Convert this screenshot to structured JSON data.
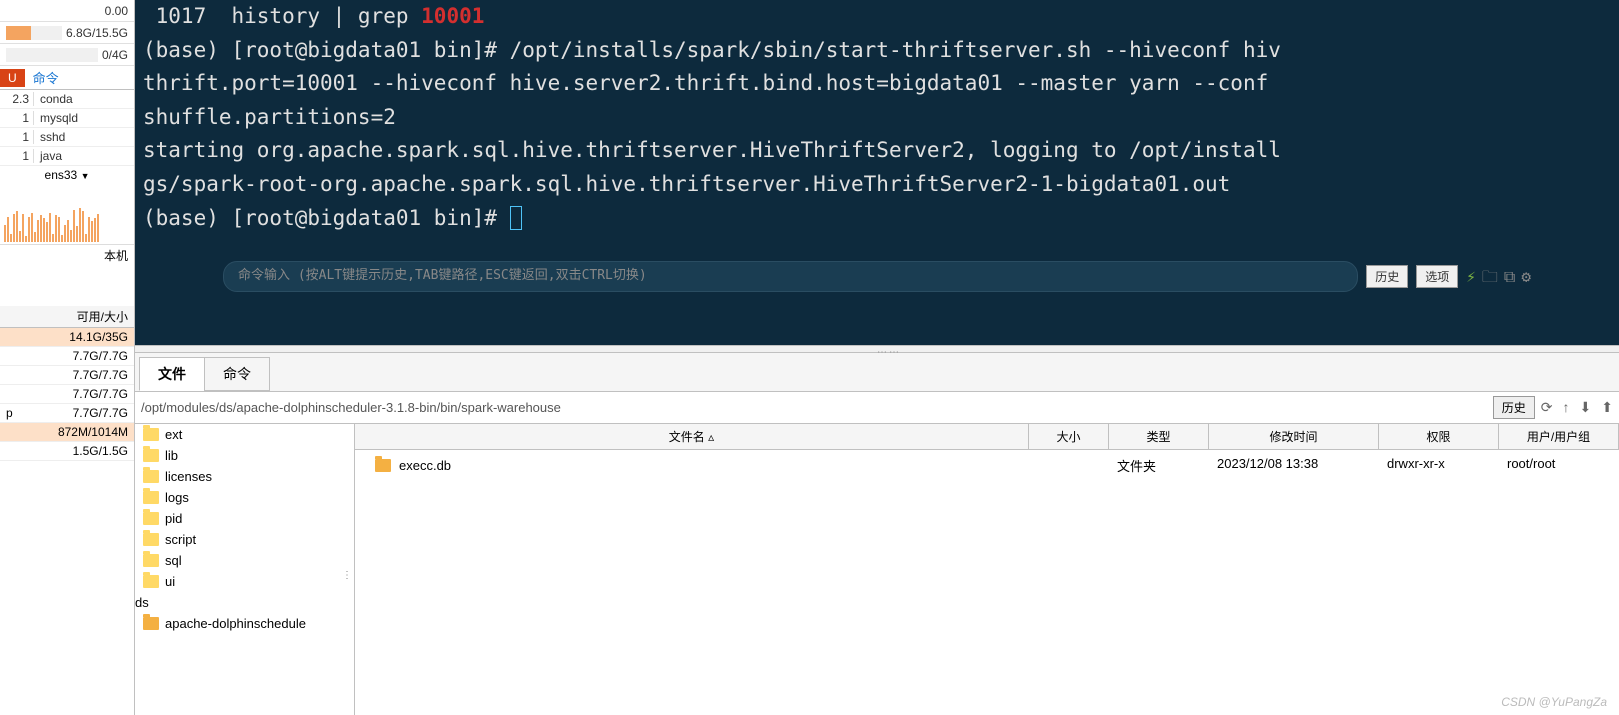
{
  "stats": {
    "top_val": "0.00",
    "mem": "6.8G/15.5G",
    "swap": "0/4G"
  },
  "cmd_header": {
    "badge": "U",
    "label": "命令"
  },
  "procs": [
    {
      "n": "2.3",
      "name": "conda"
    },
    {
      "n": "1",
      "name": "mysqld"
    },
    {
      "n": "1",
      "name": "sshd"
    },
    {
      "n": "1",
      "name": "java"
    }
  ],
  "net": {
    "iface": "ens33",
    "footer": "本机"
  },
  "disk_header": "可用/大小",
  "disks": [
    {
      "label": "",
      "val": "14.1G/35G",
      "hl": true
    },
    {
      "label": "",
      "val": "7.7G/7.7G",
      "hl": false
    },
    {
      "label": "",
      "val": "7.7G/7.7G",
      "hl": false
    },
    {
      "label": "",
      "val": "7.7G/7.7G",
      "hl": false
    },
    {
      "label": "p",
      "val": "7.7G/7.7G",
      "hl": false
    },
    {
      "label": "",
      "val": "872M/1014M",
      "hl": true
    },
    {
      "label": "",
      "val": "1.5G/1.5G",
      "hl": false
    }
  ],
  "terminal": {
    "l1a": " 1017  history | grep ",
    "l1b": "10001",
    "l2": "(base) [root@bigdata01 bin]# /opt/installs/spark/sbin/start-thriftserver.sh --hiveconf hiv",
    "l3": "thrift.port=10001 --hiveconf hive.server2.thrift.bind.host=bigdata01 --master yarn --conf ",
    "l4": "shuffle.partitions=2",
    "l5": "starting org.apache.spark.sql.hive.thriftserver.HiveThriftServer2, logging to /opt/install",
    "l6": "gs/spark-root-org.apache.spark.sql.hive.thriftserver.HiveThriftServer2-1-bigdata01.out",
    "l7": "(base) [root@bigdata01 bin]# "
  },
  "cmd_input": {
    "placeholder": "命令输入 (按ALT键提示历史,TAB键路径,ESC键返回,双击CTRL切换)",
    "history": "历史",
    "options": "选项"
  },
  "tabs": {
    "files": "文件",
    "cmd": "命令"
  },
  "path": "/opt/modules/ds/apache-dolphinscheduler-3.1.8-bin/bin/spark-warehouse",
  "path_history": "历史",
  "tree": [
    "ext",
    "lib",
    "licenses",
    "logs",
    "pid",
    "script",
    "sql",
    "ui"
  ],
  "tree_parent": "ds",
  "tree_sibling": "apache-dolphinschedule",
  "list_headers": {
    "name": "文件名",
    "size": "大小",
    "type": "类型",
    "date": "修改时间",
    "perm": "权限",
    "user": "用户/用户组"
  },
  "list_rows": [
    {
      "name": "execc.db",
      "size": "",
      "type": "文件夹",
      "date": "2023/12/08 13:38",
      "perm": "drwxr-xr-x",
      "user": "root/root"
    }
  ],
  "sort_arrow": "▵",
  "watermark": "CSDN @YuPangZa"
}
